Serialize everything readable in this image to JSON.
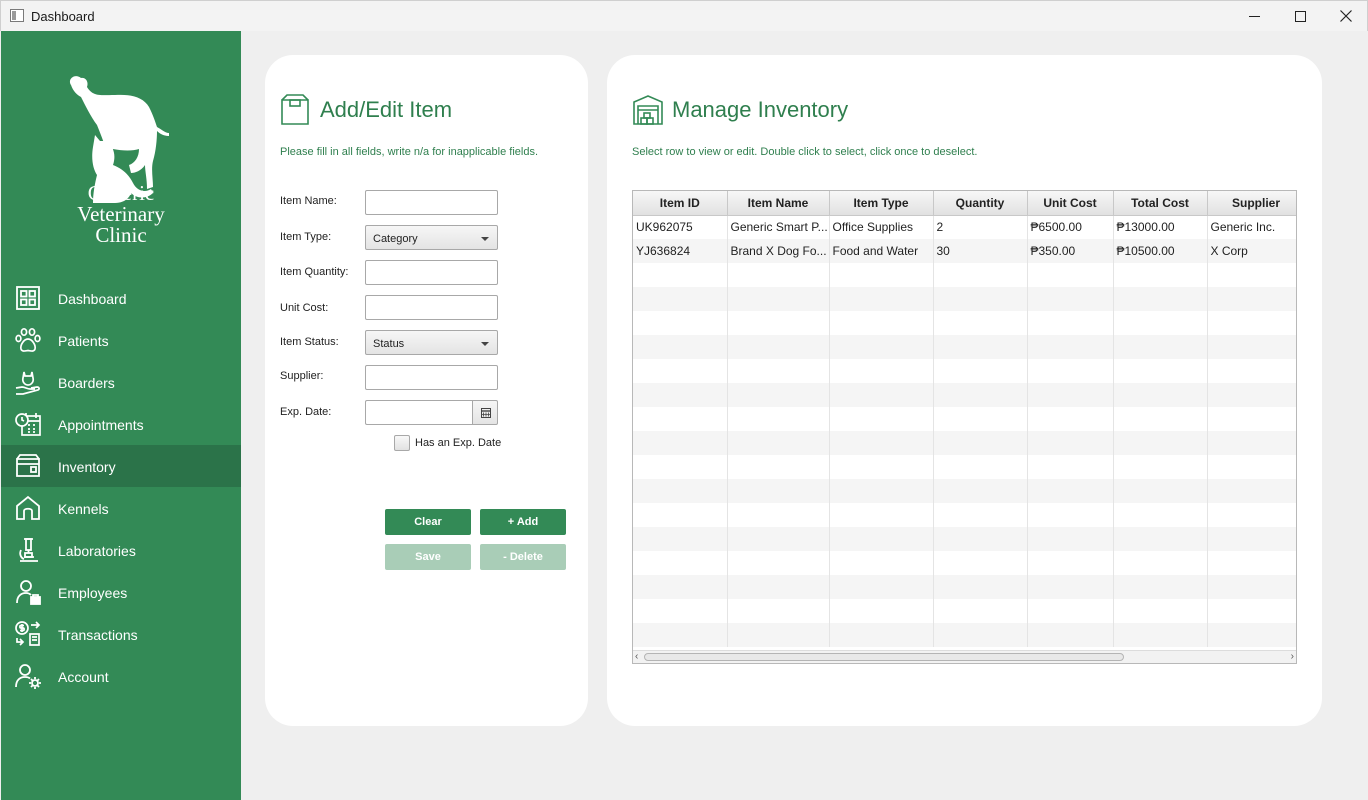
{
  "window": {
    "title": "Dashboard"
  },
  "brand": {
    "line1": "Generic",
    "line2": "Veterinary",
    "line3": "Clinic"
  },
  "nav": [
    {
      "label": "Dashboard",
      "icon": "dashboard-icon"
    },
    {
      "label": "Patients",
      "icon": "paw-icon"
    },
    {
      "label": "Boarders",
      "icon": "cat-hand-icon"
    },
    {
      "label": "Appointments",
      "icon": "calendar-clock-icon"
    },
    {
      "label": "Inventory",
      "icon": "inventory-box-icon",
      "active": true
    },
    {
      "label": "Kennels",
      "icon": "house-icon"
    },
    {
      "label": "Laboratories",
      "icon": "microscope-icon"
    },
    {
      "label": "Employees",
      "icon": "employee-icon"
    },
    {
      "label": "Transactions",
      "icon": "transactions-icon"
    },
    {
      "label": "Account",
      "icon": "account-settings-icon"
    }
  ],
  "form": {
    "title": "Add/Edit Item",
    "subtitle": "Please fill in all fields, write n/a for inapplicable fields.",
    "item_name_label": "Item Name:",
    "item_type_label": "Item Type:",
    "item_type_value": "Category",
    "item_quantity_label": "Item Quantity:",
    "unit_cost_label": "Unit Cost:",
    "item_status_label": "Item Status:",
    "item_status_value": "Status",
    "supplier_label": "Supplier:",
    "exp_date_label": "Exp. Date:",
    "has_exp_date_label": "Has an Exp. Date",
    "clear_label": "Clear",
    "add_label": "+ Add",
    "save_label": "Save",
    "delete_label": "- Delete"
  },
  "inventory": {
    "title": "Manage Inventory",
    "subtitle": "Select row to view or edit. Double click to select, click once to deselect.",
    "columns": [
      "Item ID",
      "Item Name",
      "Item Type",
      "Quantity",
      "Unit Cost",
      "Total Cost",
      "Supplier"
    ],
    "rows": [
      [
        "UK962075",
        "Generic Smart P...",
        "Office Supplies",
        "2",
        "₱6500.00",
        "₱13000.00",
        "Generic Inc."
      ],
      [
        "YJ636824",
        "Brand X Dog Fo...",
        "Food and Water",
        "30",
        "₱350.00",
        "₱10500.00",
        "X Corp"
      ]
    ]
  },
  "colors": {
    "primary": "#338a56",
    "active_nav": "#2b7349",
    "disabled": "#a9cdb7"
  }
}
